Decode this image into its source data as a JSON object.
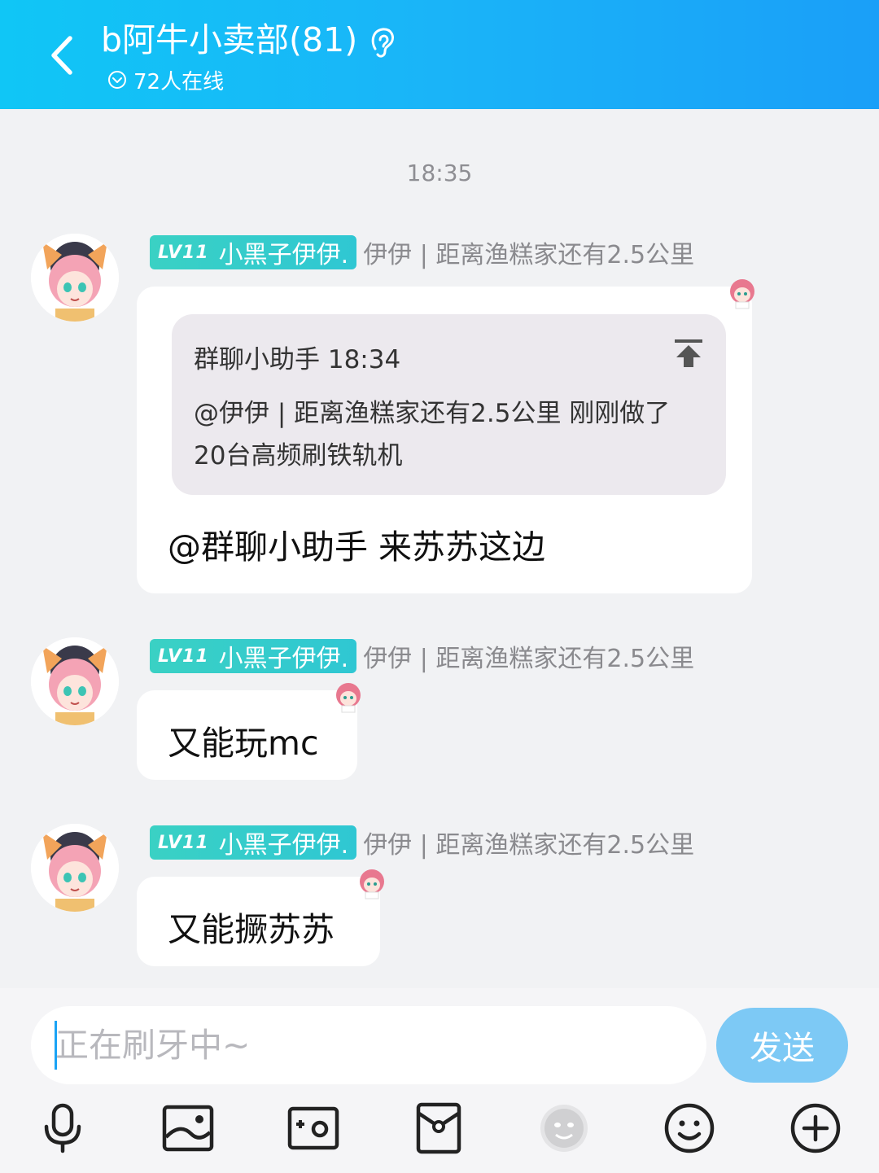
{
  "header": {
    "title": "b阿牛小卖部(81)",
    "online": "72人在线"
  },
  "chat": {
    "timestamp": "18:35",
    "messages": [
      {
        "level": "LV11",
        "nickname": "小黑子伊伊.",
        "remark": "伊伊 | 距离渔糕家还有2.5公里",
        "quote": {
          "header": "群聊小助手 18:34",
          "body": "@伊伊 | 距离渔糕家还有2.5公里 刚刚做了20台高频刷铁轨机"
        },
        "text": "@群聊小助手 来苏苏这边"
      },
      {
        "level": "LV11",
        "nickname": "小黑子伊伊.",
        "remark": "伊伊 | 距离渔糕家还有2.5公里",
        "text": "又能玩mc"
      },
      {
        "level": "LV11",
        "nickname": "小黑子伊伊.",
        "remark": "伊伊 | 距离渔糕家还有2.5公里",
        "text": "又能撅苏苏"
      }
    ]
  },
  "input": {
    "placeholder": "正在刷牙中~",
    "value": "",
    "send_label": "发送"
  },
  "toolbar": {
    "icons": [
      "microphone-icon",
      "image-icon",
      "camera-icon",
      "red-packet-icon",
      "face-sticker-icon",
      "emoji-icon",
      "plus-icon"
    ]
  },
  "colors": {
    "header_start": "#10c6f6",
    "header_end": "#1a9ff8",
    "level_tag": "#3ad1c4",
    "send_button": "#7dc9f5",
    "background": "#f1f2f4"
  }
}
